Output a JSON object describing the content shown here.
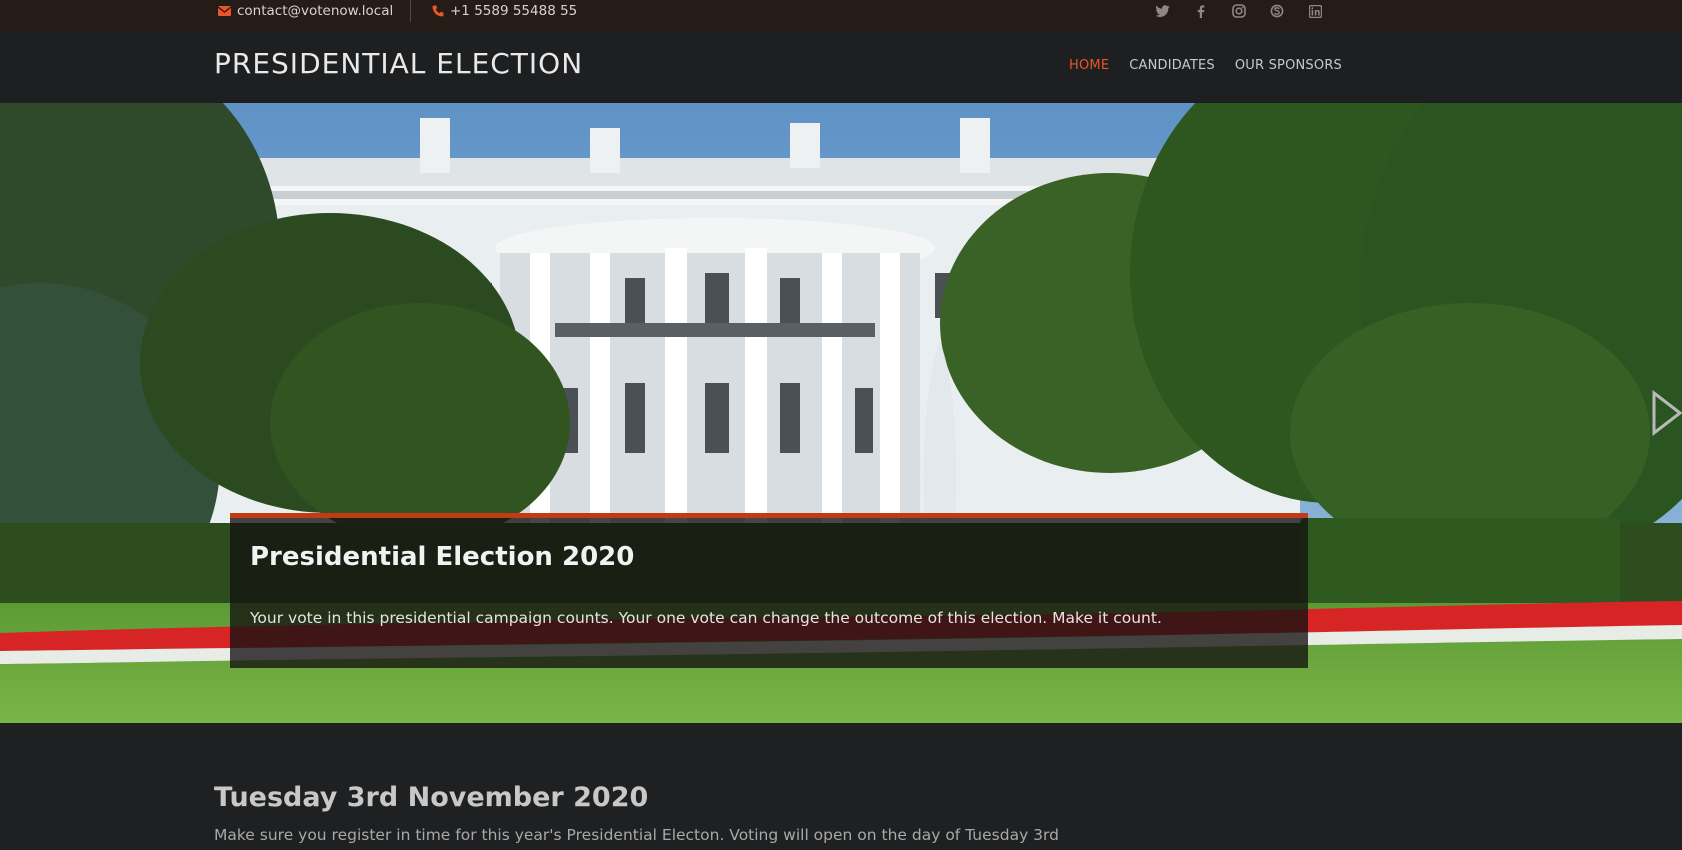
{
  "topbar": {
    "email": "contact@votenow.local",
    "phone": "+1 5589 55488 55",
    "social_icons": [
      "twitter-icon",
      "facebook-icon",
      "instagram-icon",
      "skype-icon",
      "linkedin-icon"
    ]
  },
  "header": {
    "brand": "PRESIDENTIAL ELECTION",
    "nav": [
      "HOME",
      "CANDIDATES",
      "OUR SPONSORS"
    ],
    "active_nav": "HOME"
  },
  "hero": {
    "title": "Presidential Election 2020",
    "text": "Your vote in this presidential campaign counts. Your one vote can change the outcome of this election. Make it count."
  },
  "main": {
    "title": "Tuesday 3rd November 2020",
    "text": "Make sure you register in time for this year's Presidential Electon. Voting will open on the day of Tuesday 3rd"
  },
  "colors": {
    "accent": "#e8562a",
    "caption_border": "#c23b14",
    "topbar_bg": "#251c18",
    "header_bg": "#1e1f20",
    "page_bg": "#1f2021"
  }
}
